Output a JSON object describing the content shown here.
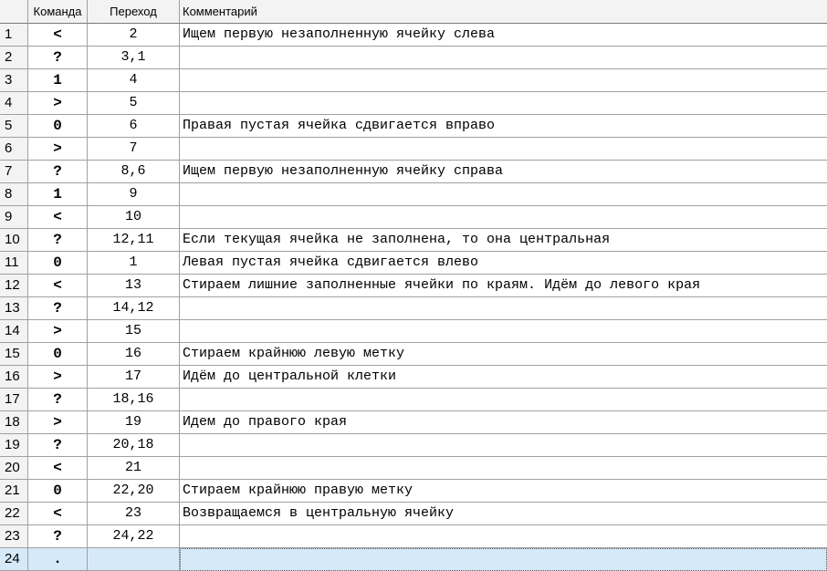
{
  "headers": {
    "row_number": "",
    "command": "Команда",
    "jump": "Переход",
    "comment": "Комментарий"
  },
  "selected_row": 24,
  "rows": [
    {
      "n": "1",
      "cmd": "<",
      "jump": "2",
      "comment": "Ищем первую незаполненную ячейку слева"
    },
    {
      "n": "2",
      "cmd": "?",
      "jump": "3,1",
      "comment": ""
    },
    {
      "n": "3",
      "cmd": "1",
      "jump": "4",
      "comment": ""
    },
    {
      "n": "4",
      "cmd": ">",
      "jump": "5",
      "comment": ""
    },
    {
      "n": "5",
      "cmd": "0",
      "jump": "6",
      "comment": "Правая пустая ячейка сдвигается вправо"
    },
    {
      "n": "6",
      "cmd": ">",
      "jump": "7",
      "comment": ""
    },
    {
      "n": "7",
      "cmd": "?",
      "jump": "8,6",
      "comment": "Ищем первую незаполненную ячейку справа"
    },
    {
      "n": "8",
      "cmd": "1",
      "jump": "9",
      "comment": ""
    },
    {
      "n": "9",
      "cmd": "<",
      "jump": "10",
      "comment": ""
    },
    {
      "n": "10",
      "cmd": "?",
      "jump": "12,11",
      "comment": "Если текущая ячейка не заполнена, то она центральная"
    },
    {
      "n": "11",
      "cmd": "0",
      "jump": "1",
      "comment": "Левая пустая ячейка сдвигается влево"
    },
    {
      "n": "12",
      "cmd": "<",
      "jump": "13",
      "comment": "Стираем лишние заполненные ячейки по краям. Идём до левого края"
    },
    {
      "n": "13",
      "cmd": "?",
      "jump": "14,12",
      "comment": ""
    },
    {
      "n": "14",
      "cmd": ">",
      "jump": "15",
      "comment": ""
    },
    {
      "n": "15",
      "cmd": "0",
      "jump": "16",
      "comment": "Стираем крайнюю левую метку"
    },
    {
      "n": "16",
      "cmd": ">",
      "jump": "17",
      "comment": "Идём до центральной клетки"
    },
    {
      "n": "17",
      "cmd": "?",
      "jump": "18,16",
      "comment": ""
    },
    {
      "n": "18",
      "cmd": ">",
      "jump": "19",
      "comment": "Идем до правого края"
    },
    {
      "n": "19",
      "cmd": "?",
      "jump": "20,18",
      "comment": ""
    },
    {
      "n": "20",
      "cmd": "<",
      "jump": "21",
      "comment": ""
    },
    {
      "n": "21",
      "cmd": "0",
      "jump": "22,20",
      "comment": "Стираем крайнюю правую метку"
    },
    {
      "n": "22",
      "cmd": "<",
      "jump": "23",
      "comment": "Возвращаемся в центральную ячейку"
    },
    {
      "n": "23",
      "cmd": "?",
      "jump": "24,22",
      "comment": ""
    },
    {
      "n": "24",
      "cmd": ".",
      "jump": "",
      "comment": ""
    }
  ]
}
